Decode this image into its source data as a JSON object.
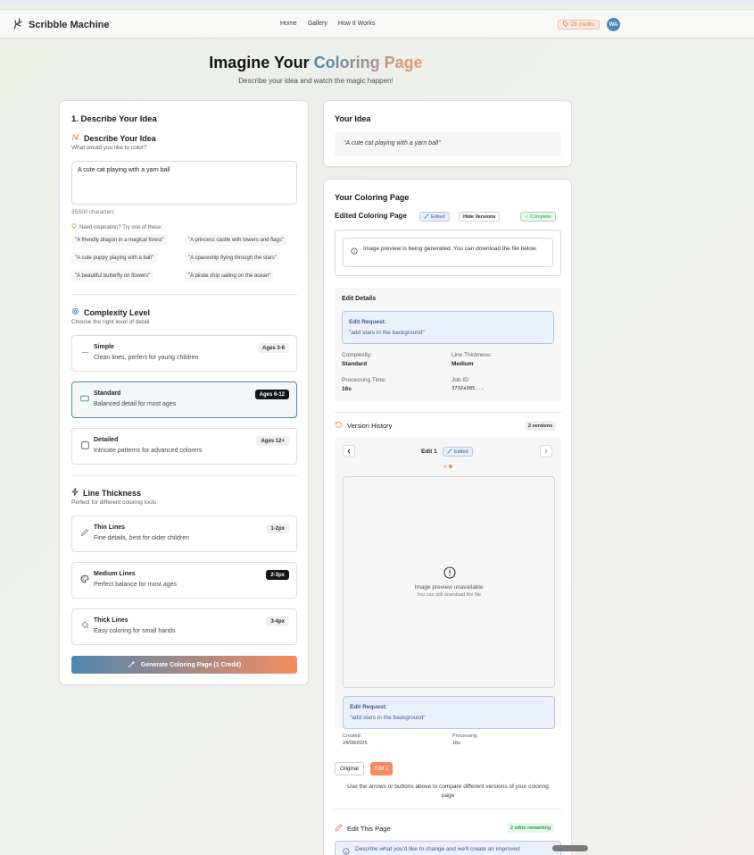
{
  "nav": {
    "brand": "Scribble Machine",
    "links": [
      "Home",
      "Gallery",
      "How It Works"
    ],
    "credits": "28 credits",
    "avatar": "WA"
  },
  "hero": {
    "title_plain": "Imagine Your",
    "title_accent": "Coloring Page",
    "subtitle": "Describe your idea and watch the magic happen!"
  },
  "left": {
    "card_title": "1. Describe Your Idea",
    "describe_heading": "Describe Your Idea",
    "describe_sub": "What would you like to color?",
    "textarea_value": "A cute cat playing with a yarn ball",
    "char_count": "35/500 characters",
    "inspiration_label": "Need inspiration? Try one of these:",
    "suggestions": [
      "\"A friendly dragon in a magical forest\"",
      "\"A princess castle with towers and flags\"",
      "\"A cute puppy playing with a ball\"",
      "\"A spaceship flying through the stars\"",
      "\"A beautiful butterfly on flowers\"",
      "\"A pirate ship sailing on the ocean\""
    ],
    "complexity_heading": "Complexity Level",
    "complexity_sub": "Choose the right level of detail",
    "complexity_options": [
      {
        "title": "Simple",
        "desc": "Clean lines, perfect for young children",
        "badge": "Ages 3-6"
      },
      {
        "title": "Standard",
        "desc": "Balanced detail for most ages",
        "badge": "Ages 6-12"
      },
      {
        "title": "Detailed",
        "desc": "Intricate patterns for advanced colorers",
        "badge": "Ages 12+"
      }
    ],
    "line_heading": "Line Thickness",
    "line_sub": "Perfect for different coloring tools",
    "line_options": [
      {
        "title": "Thin Lines",
        "desc": "Fine details, best for older children",
        "badge": "1-2px"
      },
      {
        "title": "Medium Lines",
        "desc": "Perfect balance for most ages",
        "badge": "2-3px"
      },
      {
        "title": "Thick Lines",
        "desc": "Easy coloring for small hands",
        "badge": "3-4px"
      }
    ],
    "generate_label": "Generate Coloring Page (1 Credit)"
  },
  "idea": {
    "title": "Your Idea",
    "text": "\"A cute cat playing with a yarn ball\""
  },
  "page": {
    "title": "Your Coloring Page",
    "edited_title": "Edited Coloring Page",
    "edited_pill": "Edited",
    "hide_versions": "Hide Versions",
    "complete": "✓ Complete",
    "notice": "Image preview is being generated. You can download the file below.",
    "edit_details_title": "Edit Details",
    "edit_request_label": "Edit Request:",
    "edit_request_text": "\"add stars in the background\"",
    "complexity_label": "Complexity:",
    "complexity_value": "Standard",
    "thickness_label": "Line Thickness:",
    "thickness_value": "Medium",
    "processing_label": "Processing Time:",
    "processing_value": "16s",
    "job_label": "Job ID:",
    "job_value": "3732a385...",
    "version_history": "Version History",
    "versions_count": "2 versions",
    "edit_label": "Edit 1",
    "preview_unavailable": "Image preview unavailable",
    "preview_sub": "You can still download the file",
    "created_label": "Created:",
    "created_value": "24/09/2025",
    "processing2_label": "Processing:",
    "processing2_value": "16s",
    "original_btn": "Original",
    "edit1_btn": "Edit 1",
    "compare_hint": "Use the arrows or buttons above to compare different versions of your coloring page",
    "edit_this_page": "Edit This Page",
    "edits_remaining": "2 edits remaining",
    "edit_prompt": "Describe what you'd like to change and we'll create an improved"
  },
  "colors": {
    "accent_blue": "#4d88b0",
    "accent_orange": "#f58c5f"
  }
}
